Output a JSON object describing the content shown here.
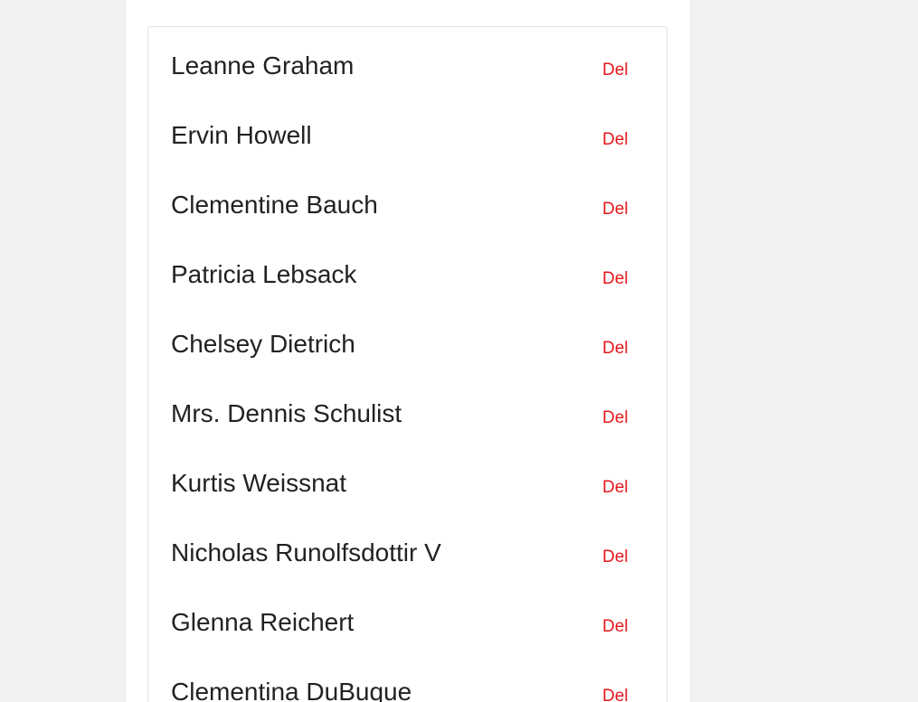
{
  "users": [
    {
      "name": "Leanne Graham",
      "action": "Del"
    },
    {
      "name": "Ervin Howell",
      "action": "Del"
    },
    {
      "name": "Clementine Bauch",
      "action": "Del"
    },
    {
      "name": "Patricia Lebsack",
      "action": "Del"
    },
    {
      "name": "Chelsey Dietrich",
      "action": "Del"
    },
    {
      "name": "Mrs. Dennis Schulist",
      "action": "Del"
    },
    {
      "name": "Kurtis Weissnat",
      "action": "Del"
    },
    {
      "name": "Nicholas Runolfsdottir V",
      "action": "Del"
    },
    {
      "name": "Glenna Reichert",
      "action": "Del"
    },
    {
      "name": "Clementina DuBuque",
      "action": "Del"
    }
  ],
  "colors": {
    "delete": "#e8171c",
    "text": "#222222",
    "background": "#f1f1f1"
  }
}
